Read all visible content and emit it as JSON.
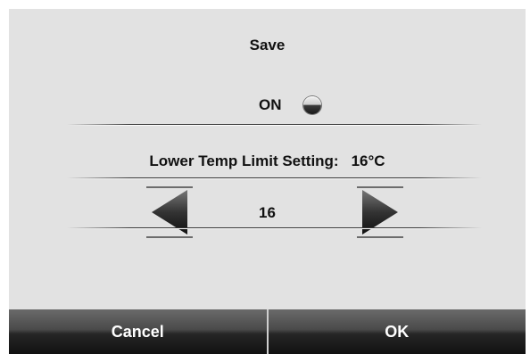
{
  "title": "Save",
  "on_label": "ON",
  "limit": {
    "label": "Lower Temp Limit Setting:",
    "value": "16°C"
  },
  "stepper_value": "16",
  "icons": {
    "decrease": "left-triangle-icon",
    "increase": "right-triangle-icon",
    "toggle": "radio-indicator-icon"
  },
  "footer": {
    "cancel_label": "Cancel",
    "ok_label": "OK"
  },
  "colors": {
    "panel": "#e2e2e2",
    "button_dark": "#1a1a1a",
    "text": "#111111"
  }
}
